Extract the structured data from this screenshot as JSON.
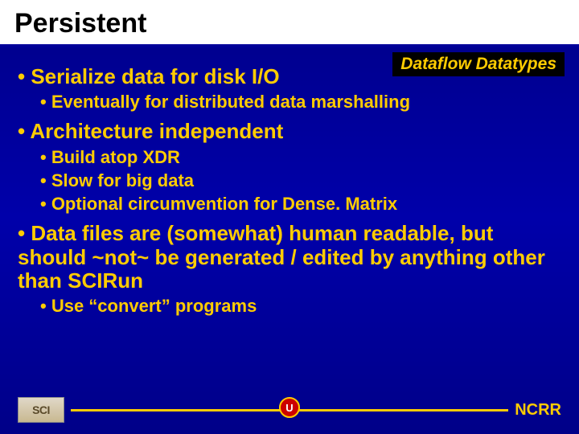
{
  "title": "Persistent",
  "badge": "Dataflow Datatypes",
  "bullets": [
    {
      "level": 1,
      "text": "• Serialize data for disk I/O"
    },
    {
      "level": 2,
      "text": "• Eventually for distributed data marshalling"
    },
    {
      "level": 1,
      "text": "• Architecture independent"
    },
    {
      "level": 2,
      "text": "• Build atop XDR"
    },
    {
      "level": 2,
      "text": "• Slow for big data"
    },
    {
      "level": 2,
      "text": "• Optional circumvention for Dense. Matrix"
    },
    {
      "level": 1,
      "text": "• Data files are (somewhat) human readable, but should ~not~ be generated / edited by anything other than SCIRun"
    },
    {
      "level": 2,
      "text": "• Use “convert” programs"
    }
  ],
  "footer": {
    "left_logo": "SCI",
    "center_logo": "U",
    "right_text": "NCRR"
  }
}
